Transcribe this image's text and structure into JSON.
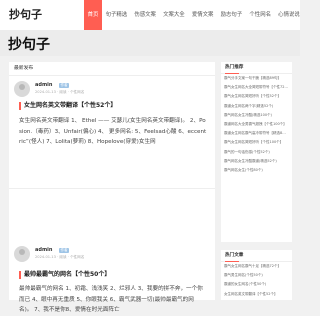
{
  "header": {
    "logo": "抄句子",
    "nav": [
      {
        "label": "首页",
        "active": true
      },
      {
        "label": "句子精选",
        "active": false
      },
      {
        "label": "伤感文案",
        "active": false
      },
      {
        "label": "文案大全",
        "active": false
      },
      {
        "label": "爱情文案",
        "active": false
      },
      {
        "label": "励志句子",
        "active": false
      },
      {
        "label": "个性网名",
        "active": false
      },
      {
        "label": "心情说说",
        "active": false
      }
    ]
  },
  "hero": {
    "title": "抄句子"
  },
  "main": {
    "section_label": "最新发布",
    "posts": [
      {
        "author": "admin",
        "badge": "作者",
        "meta": "2024-01-13 · 阅读 · 个性网名",
        "title": "女生网名英文带翻译【个性52个】",
        "excerpt": "女生网名英文带翻译 1、 Ethel —— 艾瑟儿(女生网名英文带翻译)。 2、Posion.（毒药）3、Unfair(偏心) 4、 更多网名: 5、Feelsad心酸 6、eccentric”(怪人) 7、Lolita(萝莉) 8、Hopelove(穿爱)女生网"
      },
      {
        "author": "admin",
        "badge": "作者",
        "meta": "2024-01-13 · 阅读 · 个性网名",
        "title": "最帅最霸气的网名【个性50个】",
        "excerpt": "最帅最霸气的网名 1、初霜、浅浅笑 2、烂邪人 3、我要的拼不奔，一个你而已 4、眼中再无重质 5、你眼我关 6、霸气武器一切(最帅最霸气的网名)。 7、我不是你8、爱情在时光面阵亡"
      }
    ]
  },
  "sidebar": {
    "hot_title": "热门推荐",
    "hot_items": [
      "霸气分手文案一句干脆【精选89句】",
      "霸气女生网名大全简短带符号【个性72…",
      "霸气女生网名简短好听【个性52个】",
      "霸道女生网名两个字(精选52个)",
      "霸气网名女生冷酷(精选100个)",
      "霸道网名大全男霸气超拽【个性100个】",
      "霸道女生网名霸气高冷带符号【精选8…",
      "霸气女生网名简短好听【个性100个】",
      "霸气的一句话伤感(个性52个)",
      "霸气网名女生冷酷霸道(精选52个)",
      "霸气网名女生(个性80个)"
    ],
    "recommend_title": "热门文章",
    "recommend_items": [
      "霸气女生网名霸气十足【精选72个】",
      "霸气男生网名(个性50个)",
      "霸道的女生网名(个性50个)",
      "女生网名英文带翻译【个性52个】",
      "霸气女生网名简短好听(个性82个)"
    ]
  }
}
